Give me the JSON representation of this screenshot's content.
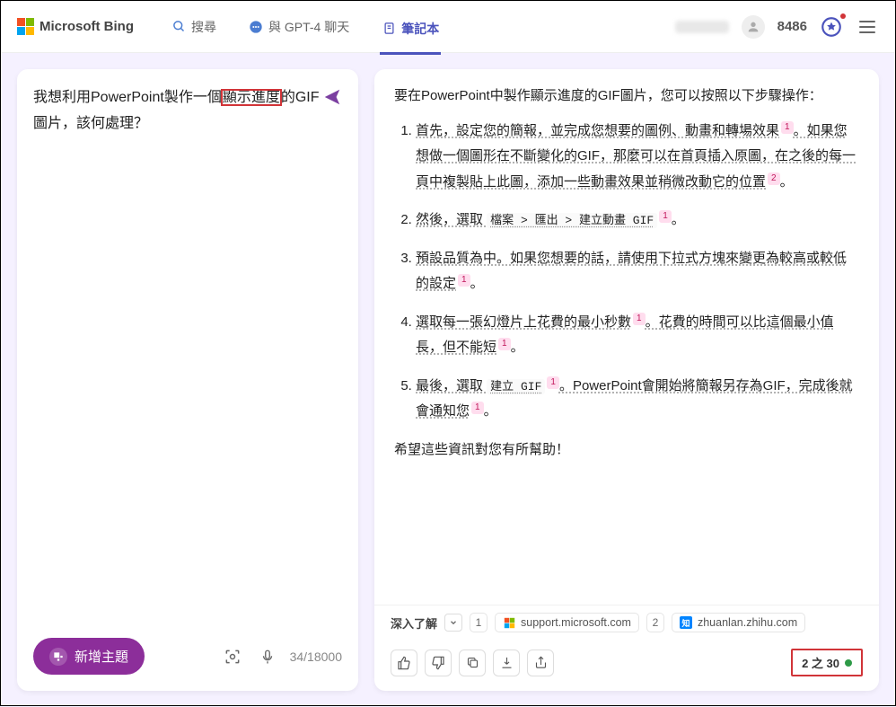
{
  "header": {
    "brand": "Microsoft Bing",
    "tabs": {
      "search": "搜尋",
      "chat": "與 GPT-4 聊天",
      "notebook": "筆記本"
    },
    "points": "8486"
  },
  "left": {
    "query_pre": "我想利用PowerPoint製作一個",
    "query_hl": "顯示進度",
    "query_post": "的GIF圖片，該何處理？",
    "new_topic": "新增主題",
    "char_count": "34/18000"
  },
  "answer": {
    "intro": "要在PowerPoint中製作顯示進度的GIF圖片，您可以按照以下步驟操作：",
    "step1a": "首先，設定您的簡報，並完成您想要的圖例、動畫和轉場效果",
    "step1b": "。如果您想做一個圖形在不斷變化的GIF，那麼可以在首頁插入原圖，在之後的每一頁中複製貼上此圖，添加一些動畫效果並稍微改動它的位置",
    "step1c": "。",
    "step2a": "然後，選取 ",
    "step2_code": "檔案 > 匯出 > 建立動畫 GIF",
    "step2b": "。",
    "step3a": "預設品質為中。如果您想要的話，請使用下拉式方塊來變更為較高或較低的設定",
    "step3b": "。",
    "step4a": "選取每一張幻燈片上花費的最小秒數",
    "step4b": "。花費的時間可以比這個最小值長，但不能短",
    "step4c": "。",
    "step5a": "最後，選取 ",
    "step5_code": "建立 GIF",
    "step5b": "。PowerPoint會開始將簡報另存為GIF，完成後就會通知您",
    "step5c": "。",
    "outro": "希望這些資訊對您有所幫助！"
  },
  "learn": {
    "label": "深入了解",
    "src1_num": "1",
    "src1_text": "support.microsoft.com",
    "src2_num": "2",
    "src2_text": "zhuanlan.zhihu.com"
  },
  "turn": {
    "text": "2 之 30"
  },
  "cites": {
    "c1": "1",
    "c2": "2"
  }
}
